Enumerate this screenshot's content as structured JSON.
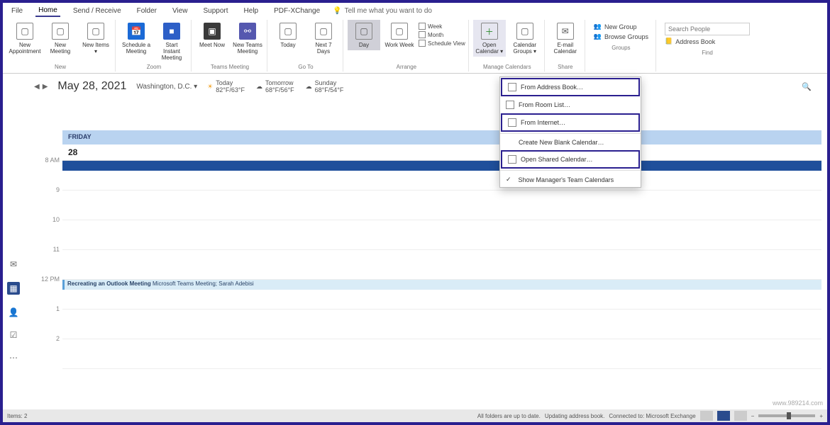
{
  "tabs": [
    "File",
    "Home",
    "Send / Receive",
    "Folder",
    "View",
    "Support",
    "Help",
    "PDF-XChange"
  ],
  "active_tab": "Home",
  "tellme": "Tell me what you want to do",
  "ribbon": {
    "new_appointment": "New Appointment",
    "new_meeting": "New Meeting",
    "new_items": "New Items ▾",
    "schedule_meeting": "Schedule a Meeting",
    "start_instant": "Start Instant Meeting",
    "meet_now": "Meet Now",
    "new_teams_meeting": "New Teams Meeting",
    "today": "Today",
    "next7": "Next 7 Days",
    "day": "Day",
    "work_week": "Work Week",
    "week": "Week",
    "month": "Month",
    "schedule_view": "Schedule View",
    "open_calendar": "Open Calendar ▾",
    "calendar_groups": "Calendar Groups ▾",
    "email_calendar": "E-mail Calendar",
    "new_group": "New Group",
    "browse_groups": "Browse Groups",
    "address_book": "Address Book",
    "search_placeholder": "Search People"
  },
  "group_labels": {
    "new": "New",
    "zoom": "Zoom",
    "teams": "Teams Meeting",
    "goto": "Go To",
    "arrange": "Arrange",
    "manage": "Manage Calendars",
    "share": "Share",
    "groups": "Groups",
    "find": "Find"
  },
  "datebar": {
    "date": "May 28, 2021",
    "location": "Washington, D.C. ▾",
    "today_label": "Today",
    "today_temp": "82°F/63°F",
    "tomorrow_label": "Tomorrow",
    "tomorrow_temp": "68°F/56°F",
    "sunday_label": "Sunday",
    "sunday_temp": "68°F/54°F"
  },
  "calendar": {
    "day_label": "FRIDAY",
    "day_number": "28",
    "times": [
      "8 AM",
      "9",
      "10",
      "11",
      "12 PM",
      "1",
      "2"
    ],
    "event_title": "Recreating an Outlook Meeting",
    "event_detail": "Microsoft Teams Meeting; Sarah Adebisi"
  },
  "dropdown": {
    "from_address_book": "From Address Book…",
    "from_room_list": "From Room List…",
    "from_internet": "From Internet…",
    "create_blank": "Create New Blank Calendar…",
    "open_shared": "Open Shared Calendar…",
    "show_managers": "Show Manager's Team Calendars"
  },
  "statusbar": {
    "items": "Items: 2",
    "folders": "All folders are up to date.",
    "updating": "Updating address book.",
    "connected": "Connected to: Microsoft Exchange"
  },
  "watermark": "www.989214.com"
}
